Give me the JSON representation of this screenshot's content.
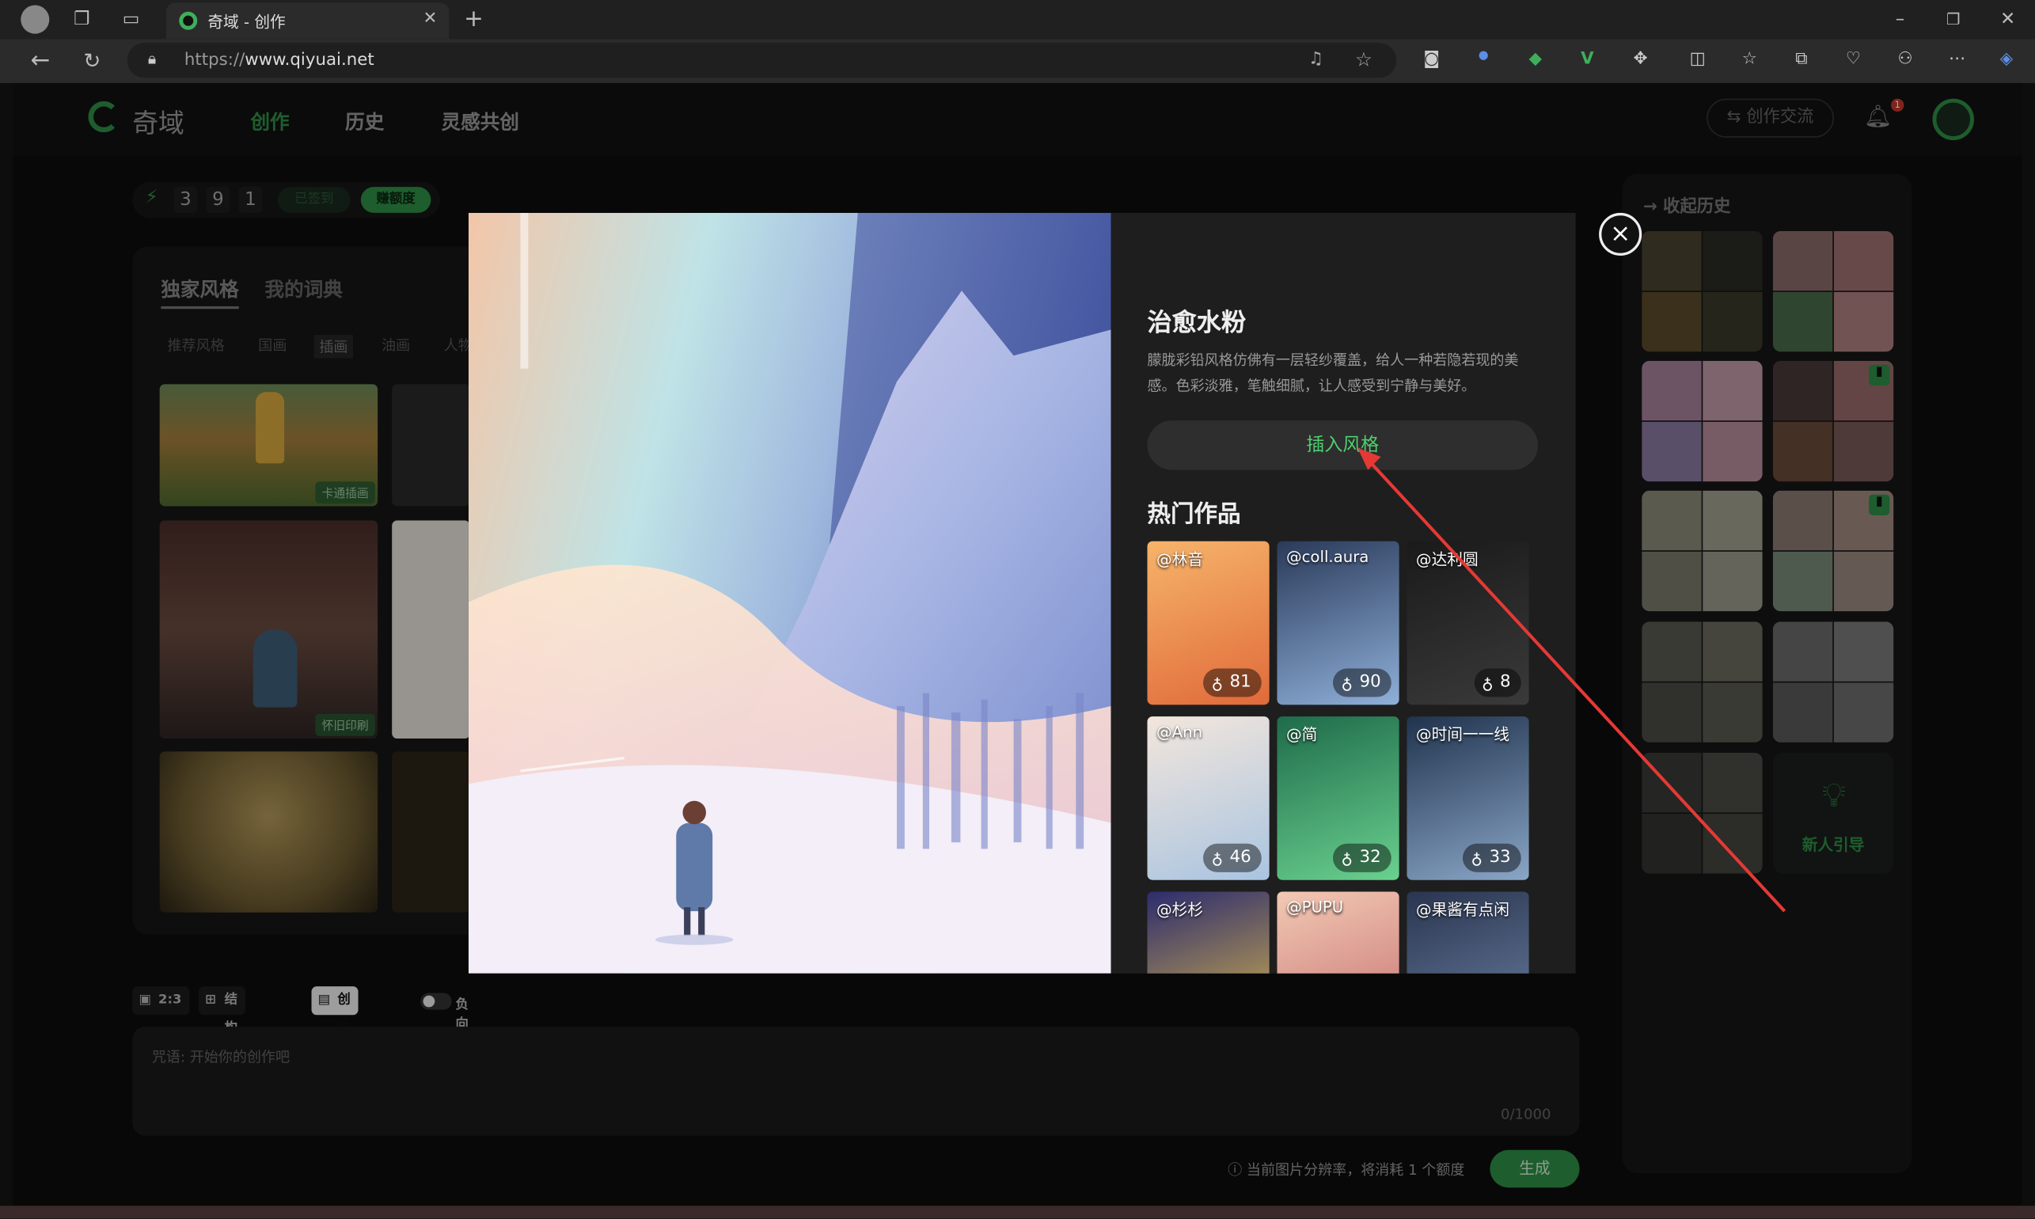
{
  "browser": {
    "tab_title": "奇域 - 创作",
    "url_prefix": "https://",
    "url_host": "www.qiyuai.net"
  },
  "nav": {
    "logo": "奇域",
    "items": [
      "创作",
      "历史",
      "灵感共创"
    ],
    "exchange_button": "创作交流",
    "notification_count": "1"
  },
  "credits": {
    "digits": [
      "3",
      "9",
      "1"
    ],
    "signed": "已签到",
    "earn": "赚额度"
  },
  "left": {
    "tabs": [
      "独家风格",
      "我的词典"
    ],
    "sub_tabs": [
      "推荐风格",
      "国画",
      "插画",
      "油画",
      "人物"
    ],
    "labels": [
      "卡通插画",
      "怀旧印刷"
    ]
  },
  "history": {
    "title": "收起历史",
    "guide": "新人引导"
  },
  "toolbar": {
    "ratio": "2:3",
    "reference": "结构参考图",
    "book": "创作宝典",
    "negative": "负向咒语"
  },
  "prompt": {
    "placeholder": "咒语: 开始你的创作吧",
    "counter": "0/1000"
  },
  "footer": {
    "warning": "当前图片分辨率，将消耗 1 个额度",
    "generate": "生成"
  },
  "modal": {
    "title": "治愈水粉",
    "desc": "朦胧彩铅风格仿佛有一层轻纱覆盖，给人一种若隐若现的美感。色彩淡雅，笔触细腻，让人感受到宁静与美好。",
    "insert": "插入风格",
    "hot_title": "热门作品",
    "close": "×",
    "works": [
      {
        "user": "@林音",
        "likes": "81",
        "c1": "#f6b46a",
        "c2": "#e06a3a"
      },
      {
        "user": "@coll.aura",
        "likes": "90",
        "c1": "#2a3a5a",
        "c2": "#8fb0d9"
      },
      {
        "user": "@达利圆",
        "likes": "8",
        "c1": "#1a1a1a",
        "c2": "#3a3a3a"
      },
      {
        "user": "@Ann",
        "likes": "46",
        "c1": "#f3e6dc",
        "c2": "#a9c4e0"
      },
      {
        "user": "@简",
        "likes": "32",
        "c1": "#1e6b4a",
        "c2": "#6ad18f"
      },
      {
        "user": "@时间一一线",
        "likes": "33",
        "c1": "#20334d",
        "c2": "#8aa6c7"
      },
      {
        "user": "@杉杉",
        "likes": "",
        "c1": "#2c2c6e",
        "c2": "#e8c24a"
      },
      {
        "user": "@PUPU",
        "likes": "",
        "c1": "#f2c9b4",
        "c2": "#c36b6b"
      },
      {
        "user": "@果酱有点闲",
        "likes": "",
        "c1": "#2a3550",
        "c2": "#6f86a8"
      }
    ]
  }
}
